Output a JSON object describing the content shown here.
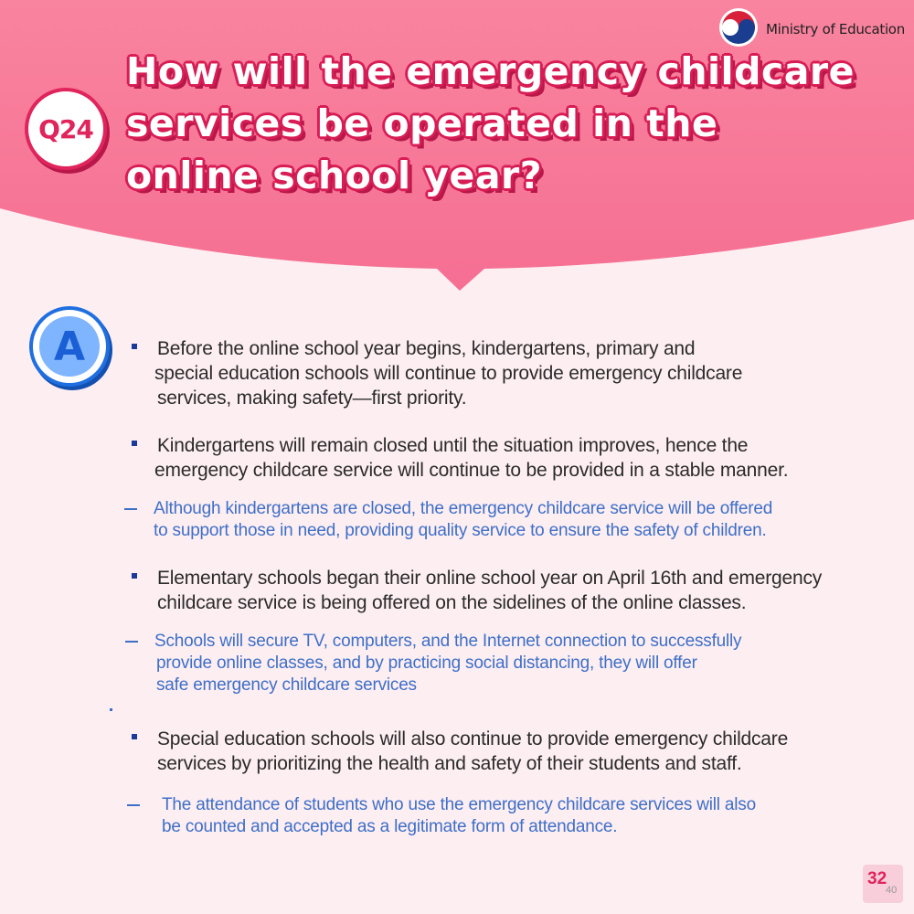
{
  "header": {
    "ministry": "Ministry of Education",
    "question_number": "Q24",
    "question_lines": [
      "How will the emergency childcare",
      "services be operated in the",
      "online school year?"
    ]
  },
  "answer_badge": "A",
  "items": [
    {
      "lines": [
        "Before the online school year begins, kindergartens, primary and",
        "special education schools will continue to provide emergency childcare",
        "services, making safety—first priority."
      ]
    },
    {
      "lines": [
        "Kindergartens will remain closed until the situation improves, hence the",
        "emergency childcare service will continue to be provided in a stable manner."
      ],
      "sub": [
        "Although kindergartens are closed, the emergency childcare service will be offered",
        "to support those in need, providing quality service to ensure the safety of children."
      ]
    },
    {
      "lines": [
        "Elementary schools began their online school year on April 16th and emergency",
        "childcare service is being offered on the sidelines of the online classes."
      ],
      "sub": [
        "Schools will secure TV, computers, and the Internet connection to successfully",
        "provide online classes, and by practicing social distancing, they will offer",
        "safe emergency childcare services"
      ]
    },
    {
      "lines": [
        "Special education schools will also continue to provide emergency childcare",
        "services by prioritizing the health and safety of their students and staff."
      ],
      "sub": [
        "The attendance of students who use the emergency childcare services will also",
        "be counted and accepted as a legitimate form of attendance."
      ]
    }
  ],
  "page": {
    "current": "32",
    "total": "40"
  },
  "colors": {
    "header_pink": "#f77a9a",
    "accent_red": "#e0245c",
    "accent_blue": "#1f6fe0",
    "sub_text_blue": "#3e6fc7",
    "background": "#fdeef2"
  },
  "icons": {
    "logo": "taegeuk-emblem-icon"
  }
}
